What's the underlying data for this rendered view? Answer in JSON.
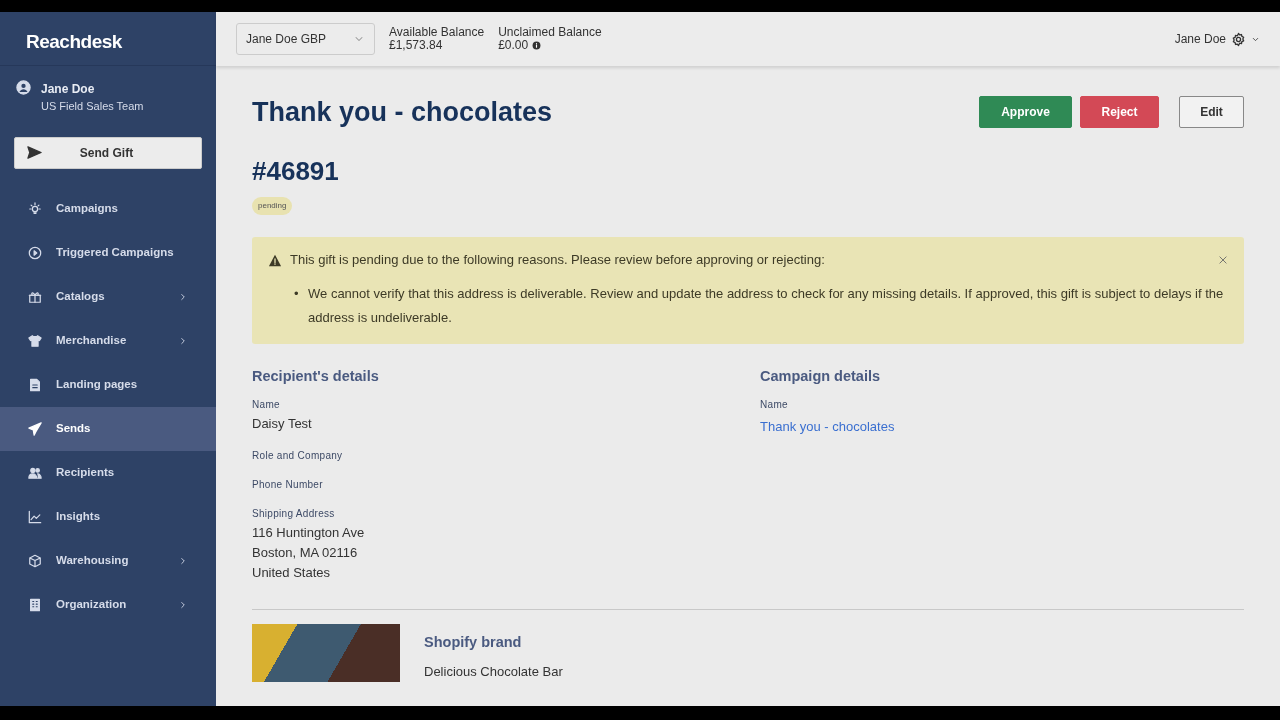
{
  "sidebar": {
    "logo": "Reachdesk",
    "user": {
      "name": "Jane Doe",
      "team": "US Field Sales Team"
    },
    "send_button": "Send Gift",
    "items": [
      {
        "label": "Campaigns",
        "selected": false,
        "submenu": false
      },
      {
        "label": "Triggered Campaigns",
        "selected": false,
        "submenu": false
      },
      {
        "label": "Catalogs",
        "selected": false,
        "submenu": true
      },
      {
        "label": "Merchandise",
        "selected": false,
        "submenu": true
      },
      {
        "label": "Landing pages",
        "selected": false,
        "submenu": false
      },
      {
        "label": "Sends",
        "selected": true,
        "submenu": false
      },
      {
        "label": "Recipients",
        "selected": false,
        "submenu": false
      },
      {
        "label": "Insights",
        "selected": false,
        "submenu": false
      },
      {
        "label": "Warehousing",
        "selected": false,
        "submenu": true
      },
      {
        "label": "Organization",
        "selected": false,
        "submenu": true
      }
    ]
  },
  "topbar": {
    "account_select": "Jane Doe GBP",
    "balances": [
      {
        "label": "Available Balance",
        "value": "£1,573.84",
        "info": false
      },
      {
        "label": "Unclaimed Balance",
        "value": "£0.00",
        "info": true
      }
    ],
    "user": "Jane Doe"
  },
  "page": {
    "title": "Thank you - chocolates",
    "actions": [
      {
        "label": "Approve",
        "kind": "success"
      },
      {
        "label": "Reject",
        "kind": "danger"
      },
      {
        "label": "Edit",
        "kind": "outline"
      }
    ],
    "order_number": "#46891",
    "status": "pending",
    "alert": {
      "message": "This gift is pending due to the following reasons. Please review before approving or rejecting:",
      "reason_marker": "•",
      "reasons": [
        "We cannot verify that this address is deliverable. Review and update the address to check for any missing details. If approved, this gift is subject to delays if the address is undeliverable."
      ]
    },
    "recipient": {
      "heading": "Recipient's details",
      "fields": [
        {
          "label": "Name",
          "lines": [
            "Daisy Test"
          ]
        },
        {
          "label": "Role and Company"
        },
        {
          "label": "Phone Number"
        },
        {
          "label": "Shipping Address",
          "lines": [
            "116 Huntington Ave",
            "Boston, MA 02116",
            "United States"
          ]
        }
      ]
    },
    "campaign": {
      "heading": "Campaign details",
      "fields": [
        {
          "label": "Name",
          "link": "Thank you - chocolates"
        }
      ]
    },
    "product": {
      "brand": "Shopify brand",
      "name": "Delicious Chocolate Bar"
    }
  }
}
